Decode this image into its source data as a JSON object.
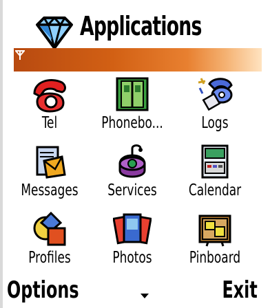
{
  "header": {
    "title": "Applications",
    "app_icon": "diamond-icon"
  },
  "status": {
    "signal_icon": "antenna-icon"
  },
  "grid": {
    "items": [
      {
        "label": "Tel",
        "icon": "telephone-icon"
      },
      {
        "label": "Phonebo...",
        "icon": "phonebook-icon"
      },
      {
        "label": "Logs",
        "icon": "logs-icon"
      },
      {
        "label": "Messages",
        "icon": "messages-icon"
      },
      {
        "label": "Services",
        "icon": "services-icon"
      },
      {
        "label": "Calendar",
        "icon": "calendar-icon"
      },
      {
        "label": "Profiles",
        "icon": "profiles-icon"
      },
      {
        "label": "Photos",
        "icon": "photos-icon"
      },
      {
        "label": "Pinboard",
        "icon": "pinboard-icon"
      }
    ]
  },
  "softkeys": {
    "left": "Options",
    "right": "Exit",
    "scroll_icon": "down-arrow-icon"
  },
  "colors": {
    "status_bar_dark": "#b84a10",
    "status_bar_light": "#ffe3c0"
  }
}
